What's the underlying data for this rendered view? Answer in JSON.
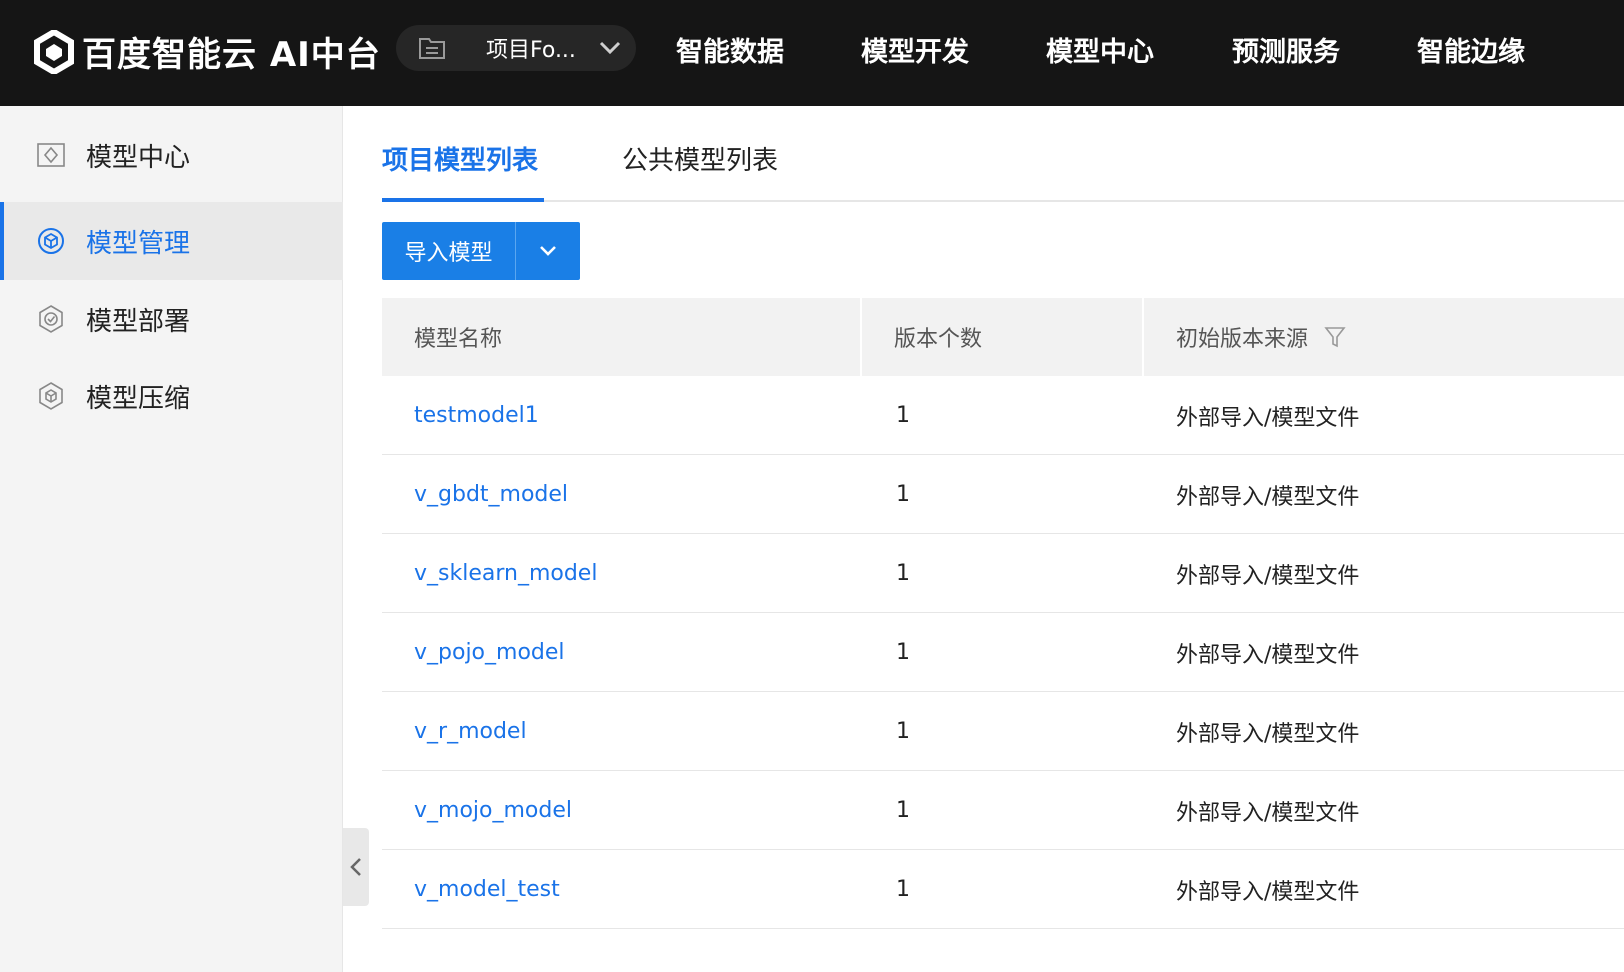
{
  "header": {
    "brand": "百度智能云 AI中台",
    "project_selector": {
      "value": "项目Fo..."
    },
    "nav": [
      "智能数据",
      "模型开发",
      "模型中心",
      "预测服务",
      "智能边缘"
    ]
  },
  "sidebar": {
    "items": [
      {
        "label": "模型中心",
        "icon": "model-center-icon",
        "active": false
      },
      {
        "label": "模型管理",
        "icon": "model-manage-icon",
        "active": true
      },
      {
        "label": "模型部署",
        "icon": "model-deploy-icon",
        "active": false
      },
      {
        "label": "模型压缩",
        "icon": "model-compress-icon",
        "active": false
      }
    ]
  },
  "tabs": [
    {
      "label": "项目模型列表",
      "active": true
    },
    {
      "label": "公共模型列表",
      "active": false
    }
  ],
  "toolbar": {
    "import_label": "导入模型"
  },
  "table": {
    "columns": [
      "模型名称",
      "版本个数",
      "初始版本来源"
    ],
    "rows": [
      {
        "name": "testmodel1",
        "versions": "1",
        "source": "外部导入/模型文件"
      },
      {
        "name": "v_gbdt_model",
        "versions": "1",
        "source": "外部导入/模型文件"
      },
      {
        "name": "v_sklearn_model",
        "versions": "1",
        "source": "外部导入/模型文件"
      },
      {
        "name": "v_pojo_model",
        "versions": "1",
        "source": "外部导入/模型文件"
      },
      {
        "name": "v_r_model",
        "versions": "1",
        "source": "外部导入/模型文件"
      },
      {
        "name": "v_mojo_model",
        "versions": "1",
        "source": "外部导入/模型文件"
      },
      {
        "name": "v_model_test",
        "versions": "1",
        "source": "外部导入/模型文件"
      }
    ]
  },
  "colors": {
    "accent": "#1a73e8",
    "topbar": "#151515",
    "sidebar": "#f4f4f4"
  }
}
